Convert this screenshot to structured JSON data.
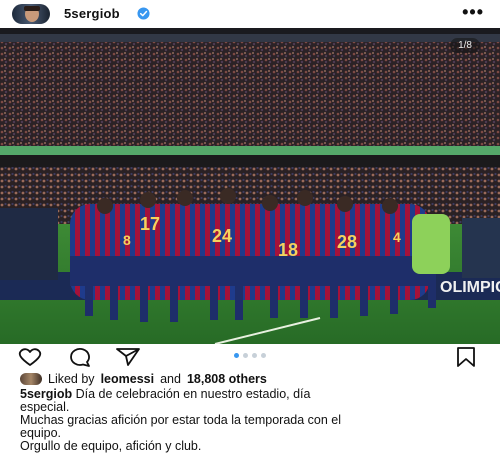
{
  "post": {
    "username": "5sergiob",
    "verified": true,
    "more_label": "•••",
    "image_counter": "1/8",
    "carousel_total_dots": 4,
    "carousel_active_index": 0
  },
  "image": {
    "banner_right": "OLIMPIC",
    "jersey_numbers": [
      "17",
      "8",
      "24",
      "18",
      "28",
      "4"
    ]
  },
  "likes": {
    "prefix": "Liked by",
    "user": "leomessi",
    "middle": "and",
    "others": "18,808 others"
  },
  "caption": {
    "username": "5sergiob",
    "line1": "Día de celebración en nuestro estadio, día",
    "line2": "especial.",
    "line3": "Muchas gracias afición por estar toda la temporada con el",
    "line4": "equipo.",
    "line5": "Orgullo de equipo, afición y club."
  },
  "colors": {
    "verified_blue": "#3897f0",
    "accent_dot": "#3897f0",
    "barca_blue": "#1f3b8c",
    "barca_red": "#a5123a",
    "pitch": "#2f7a2c"
  },
  "icons": [
    "heart-icon",
    "comment-icon",
    "share-icon",
    "bookmark-icon",
    "more-icon",
    "verified-icon"
  ]
}
